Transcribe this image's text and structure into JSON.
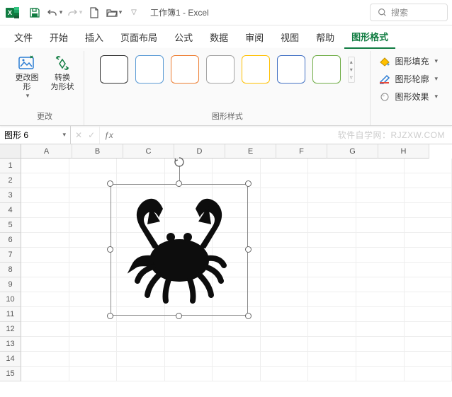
{
  "title": "工作簿1 - Excel",
  "search_placeholder": "搜索",
  "tabs": [
    "文件",
    "开始",
    "插入",
    "页面布局",
    "公式",
    "数据",
    "审阅",
    "视图",
    "帮助",
    "图形格式"
  ],
  "active_tab": 9,
  "ribbon": {
    "group_change": {
      "label": "更改",
      "change_graphic": "更改图\n形",
      "convert_to_shape": "转换\n为形状"
    },
    "group_styles": {
      "label": "图形样式",
      "swatch_borders": [
        "#333333",
        "#5b9bd5",
        "#ed7d31",
        "#a5a5a5",
        "#ffc000",
        "#4472c4",
        "#70ad47"
      ]
    },
    "side": {
      "fill": "图形填充",
      "outline": "图形轮廓",
      "effects": "图形效果"
    }
  },
  "namebox_value": "图形 6",
  "watermark": "软件自学网：RJZXW.COM",
  "columns": [
    "A",
    "B",
    "C",
    "D",
    "E",
    "F",
    "G",
    "H"
  ],
  "rows": [
    "1",
    "2",
    "3",
    "4",
    "5",
    "6",
    "7",
    "8",
    "9",
    "10",
    "11",
    "12",
    "13",
    "14",
    "15"
  ],
  "shape": {
    "name": "crab-graphic"
  }
}
